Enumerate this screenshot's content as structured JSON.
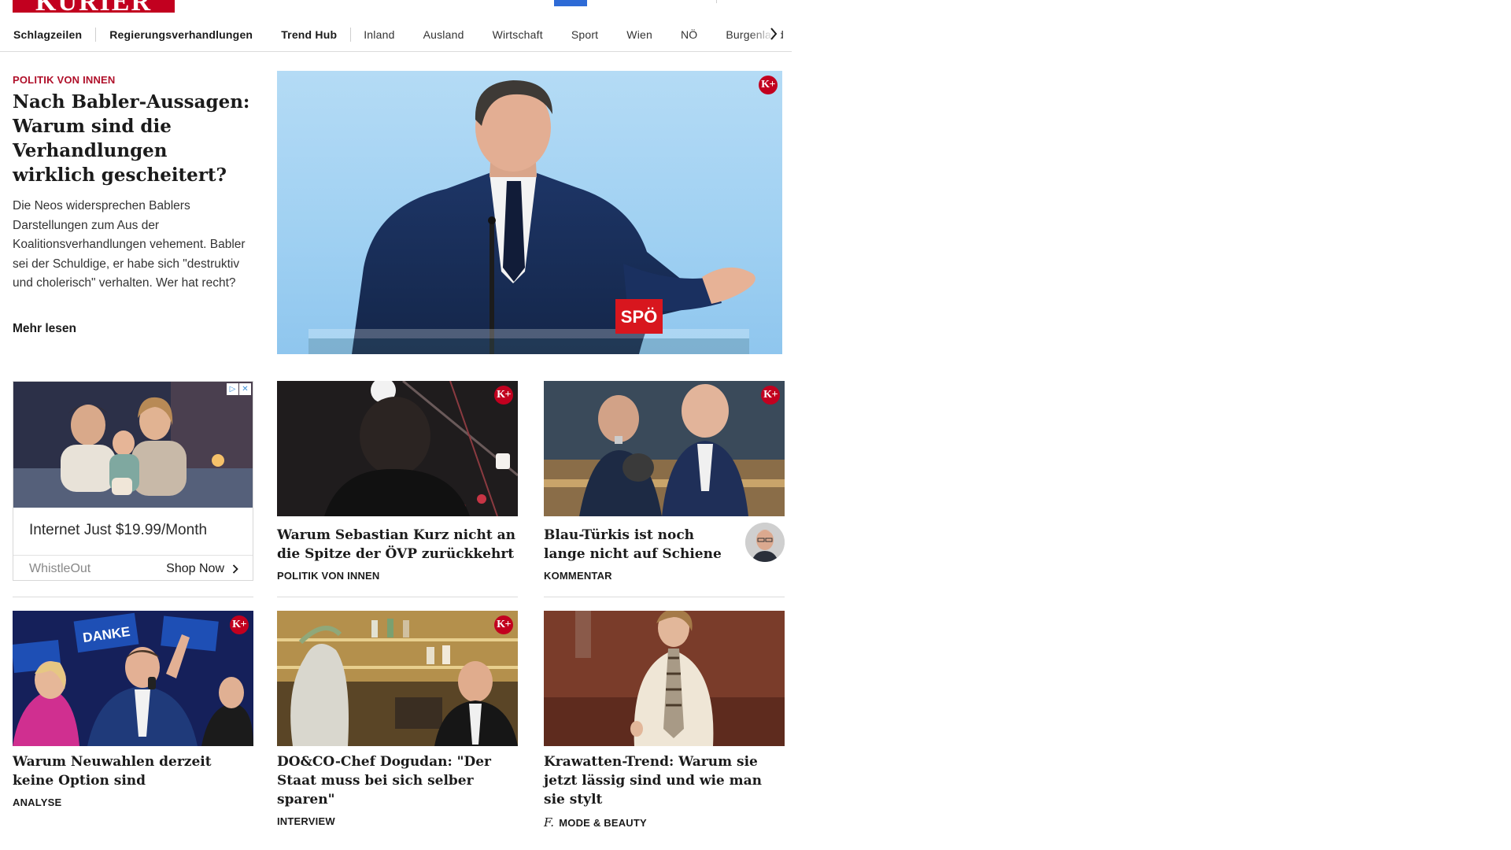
{
  "header": {
    "logo_text": "KURIER"
  },
  "nav": {
    "items": [
      {
        "label": "Schlagzeilen",
        "bold": true
      },
      {
        "label": "Regierungsverhandlungen",
        "bold": true
      },
      {
        "label": "Trend Hub",
        "bold": true
      },
      {
        "label": "Inland",
        "bold": false
      },
      {
        "label": "Ausland",
        "bold": false
      },
      {
        "label": "Wirtschaft",
        "bold": false
      },
      {
        "label": "Sport",
        "bold": false
      },
      {
        "label": "Wien",
        "bold": false
      },
      {
        "label": "NÖ",
        "bold": false
      },
      {
        "label": "Burgenland",
        "bold": false
      }
    ]
  },
  "lead": {
    "kicker": "POLITIK VON INNEN",
    "title": "Nach Babler-Aussagen: Warum sind die Verhand­lungen wirklich gescheitert?",
    "teaser": "Die Neos widersprechen Bablers Darstellungen zum Aus der Koalitionsverhandlungen vehement. Babler sei der Schuldige, er habe sich \"destruktiv und cholerisch\" verhalten. Wer hat recht?",
    "more_label": "Mehr lesen",
    "image_sign": "SPÖ",
    "premium_badge": "K+"
  },
  "ad": {
    "title": "Internet Just $19.99/Month",
    "brand": "WhistleOut",
    "cta": "Shop Now"
  },
  "cards": [
    {
      "title": "Warum Sebastian Kurz nicht an die Spitze der ÖVP zurückkehrt",
      "kicker": "POLITIK VON INNEN",
      "premium": "K+"
    },
    {
      "title": "Blau-Türkis ist noch lange nicht auf Schiene",
      "kicker": "KOMMENTAR",
      "premium": "K+"
    },
    {
      "title": "Warum Neuwahlen derzeit keine Option sind",
      "kicker": "ANALYSE",
      "premium": "K+",
      "sign": "DANKE"
    },
    {
      "title": "DO&CO-Chef Dogudan: \"Der Staat muss bei sich selber sparen\"",
      "kicker": "INTERVIEW",
      "premium": "K+"
    },
    {
      "title": "Krawatten-Trend: Warum sie jetzt lässig sind und wie man sie stylt",
      "kicker": "MODE & BEAUTY",
      "kicker_icon": "f."
    }
  ],
  "colors": {
    "brand_red": "#c2001f",
    "kicker_red": "#b0102a",
    "nav_accent_blue": "#2e6bd6"
  }
}
